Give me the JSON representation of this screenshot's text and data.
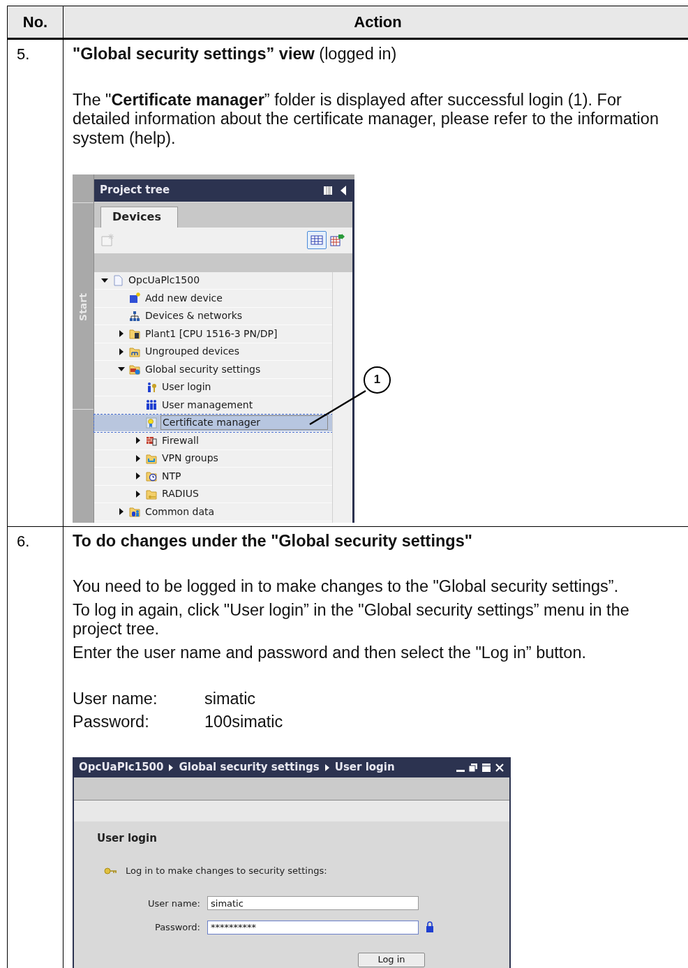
{
  "table": {
    "columns": [
      "No.",
      "Action"
    ],
    "rows": [
      {
        "number": "5.",
        "heading": "\"Global security settings” view",
        "heading_note": "(logged in)",
        "paragraphs": [
          "The \"**Certificate manager**” folder is displayed after successful login (1). For detailed information about the certificate manager, please refer to the information system (help)."
        ],
        "figure": {
          "kind": "project-tree",
          "title": "Project tree",
          "sidebar_label": "Start",
          "tabs": [
            {
              "label": "Devices",
              "selected": true
            }
          ],
          "items": [
            {
              "label": "OpcUaPlc1500",
              "kind": "project",
              "expanded": true,
              "selected": false,
              "children": [
                {
                  "label": "Add new device",
                  "kind": "add-device",
                  "selected": false
                },
                {
                  "label": "Devices & networks",
                  "kind": "network",
                  "selected": false
                },
                {
                  "label": "Plant1 [CPU 1516-3 PN/DP]",
                  "kind": "station",
                  "expanded": false,
                  "selected": false
                },
                {
                  "label": "Ungrouped devices",
                  "kind": "ungrouped",
                  "expanded": false,
                  "selected": false
                },
                {
                  "label": "Global security settings",
                  "kind": "security",
                  "expanded": true,
                  "selected": false,
                  "children": [
                    {
                      "label": "User login",
                      "kind": "user-login",
                      "selected": false
                    },
                    {
                      "label": "User management",
                      "kind": "users",
                      "selected": false
                    },
                    {
                      "label": "Certificate manager",
                      "kind": "certificate",
                      "selected": true
                    },
                    {
                      "label": "Firewall",
                      "kind": "firewall",
                      "expanded": false,
                      "selected": false
                    },
                    {
                      "label": "VPN groups",
                      "kind": "vpn",
                      "expanded": false,
                      "selected": false
                    },
                    {
                      "label": "NTP",
                      "kind": "ntp",
                      "expanded": false,
                      "selected": false
                    },
                    {
                      "label": "RADIUS",
                      "kind": "radius",
                      "expanded": false,
                      "selected": false
                    }
                  ]
                },
                {
                  "label": "Common data",
                  "kind": "common",
                  "expanded": false,
                  "selected": false
                }
              ]
            }
          ],
          "callout": "1"
        }
      },
      {
        "number": "6.",
        "heading": "To do changes under the \"Global security settings\"",
        "paragraphs": [
          "You need to be logged in to make changes to the \"Global security settings”.",
          "To log in again, click \"User login” in the \"Global security settings” menu in the project tree.",
          "Enter the user name and password and then select the \"Log in” button."
        ],
        "credentials": [
          {
            "label": "User name:",
            "value": "simatic"
          },
          {
            "label": "Password:",
            "value": "100simatic"
          }
        ],
        "figure": {
          "kind": "login-window",
          "breadcrumb": [
            "OpcUaPlc1500",
            "Global security settings",
            "User login"
          ],
          "heading": "User login",
          "message": "Log in to make changes to security settings:",
          "fields": [
            {
              "label": "User name:",
              "value": "simatic",
              "kind": "text"
            },
            {
              "label": "Password:",
              "value": "**********",
              "kind": "password"
            }
          ],
          "button": "Log in"
        }
      }
    ]
  }
}
